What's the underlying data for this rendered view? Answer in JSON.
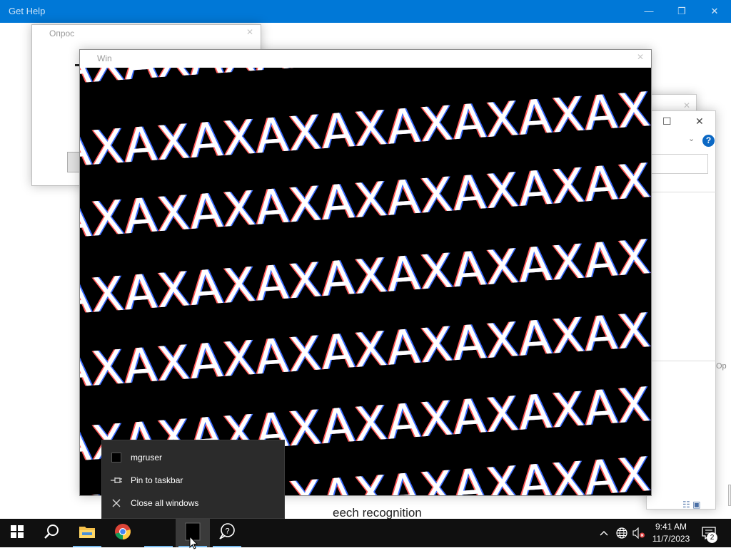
{
  "get_help": {
    "title": "Get Help",
    "controls": {
      "minimize": "—",
      "maximize": "❐",
      "close": "✕"
    }
  },
  "poll_window": {
    "title": "Опрос",
    "close": "✕"
  },
  "main_window": {
    "title": "Win",
    "close": "✕",
    "pattern_text": "AXAXAXAXAXAXAXAXAXAXAXAXAXAX"
  },
  "right_window": {
    "controls": {
      "maximize": "☐",
      "close": "✕"
    },
    "help": "?",
    "chevron": "⌄",
    "view_icons": "☷ ▣",
    "edge_label": "Op"
  },
  "background_text": {
    "speech": "eech recognition"
  },
  "jump_list": {
    "items": [
      {
        "label": "mgruser",
        "icon": "app-square-icon"
      },
      {
        "label": "Pin to taskbar",
        "icon": "pin-icon"
      },
      {
        "label": "Close all windows",
        "icon": "close-icon"
      }
    ]
  },
  "taskbar": {
    "apps": [
      "start",
      "search",
      "file-explorer",
      "chrome",
      "app-window",
      "feedback-hub"
    ],
    "clock_time": "9:41 AM",
    "clock_date": "11/7/2023",
    "notification_count": "2"
  },
  "colors": {
    "titlebar": "#0078d7",
    "taskbar": "#101010",
    "jumplist": "#2b2b2b",
    "accent_underline": "#76b9ed"
  }
}
